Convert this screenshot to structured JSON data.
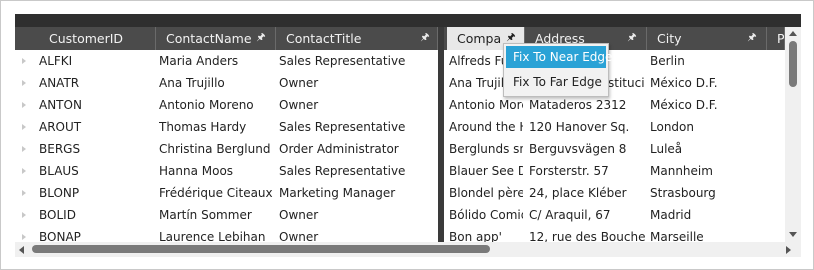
{
  "columns": [
    {
      "label": "CustomerID",
      "pinned": false
    },
    {
      "label": "ContactName",
      "pinned": true
    },
    {
      "label": "ContactTitle",
      "pinned": true
    },
    {
      "label": "Compa",
      "pinned": true,
      "active": true
    },
    {
      "label": "Address",
      "pinned": true
    },
    {
      "label": "City",
      "pinned": true
    },
    {
      "label": "P",
      "pinned": false
    }
  ],
  "rows": [
    {
      "id": "ALFKI",
      "name": "Maria Anders",
      "title": "Sales Representative",
      "company": "Alfreds Fu",
      "address": "",
      "city": "Berlin"
    },
    {
      "id": "ANATR",
      "name": "Ana Trujillo",
      "title": "Owner",
      "company": "Ana Trujill",
      "address": "stitucio",
      "city": "México D.F."
    },
    {
      "id": "ANTON",
      "name": "Antonio Moreno",
      "title": "Owner",
      "company": "Antonio More",
      "address": "Mataderos  2312",
      "city": "México D.F."
    },
    {
      "id": "AROUT",
      "name": "Thomas Hardy",
      "title": "Sales Representative",
      "company": "Around the Ho",
      "address": "120 Hanover Sq.",
      "city": "London"
    },
    {
      "id": "BERGS",
      "name": "Christina Berglund",
      "title": "Order Administrator",
      "company": "Berglunds sna",
      "address": "Berguvsvägen  8",
      "city": "Luleå"
    },
    {
      "id": "BLAUS",
      "name": "Hanna Moos",
      "title": "Sales Representative",
      "company": "Blauer See Del",
      "address": "Forsterstr. 57",
      "city": "Mannheim"
    },
    {
      "id": "BLONP",
      "name": "Frédérique Citeaux",
      "title": "Marketing Manager",
      "company": "Blondel père e",
      "address": "24, place Kléber",
      "city": "Strasbourg"
    },
    {
      "id": "BOLID",
      "name": "Martín Sommer",
      "title": "Owner",
      "company": "Bólido Comida",
      "address": "C/ Araquil, 67",
      "city": "Madrid"
    },
    {
      "id": "BONAP",
      "name": "Laurence Lebihan",
      "title": "Owner",
      "company": "Bon app'",
      "address": "12, rue des Bouchers",
      "city": "Marseille"
    }
  ],
  "context_menu": {
    "items": [
      "Fix To Near Edge",
      "Fix To Far Edge"
    ],
    "highlighted": 0
  },
  "pin_icon": "pin-icon",
  "colors": {
    "header_bg": "#4b4b4b",
    "menu_highlight": "#2aa2d6"
  }
}
